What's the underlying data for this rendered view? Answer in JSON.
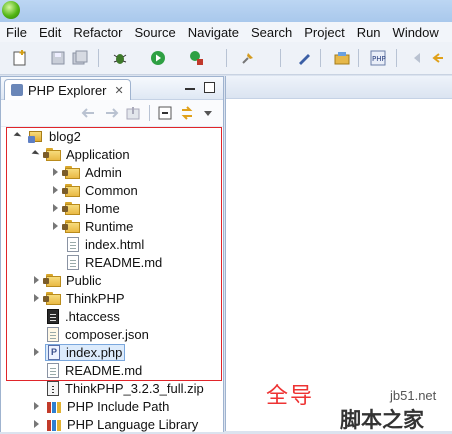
{
  "menu": [
    "File",
    "Edit",
    "Refactor",
    "Source",
    "Navigate",
    "Search",
    "Project",
    "Run",
    "Window"
  ],
  "explorer": {
    "tab_title": "PHP Explorer",
    "tab_close": "✕"
  },
  "tree": [
    {
      "label": "blog2"
    },
    {
      "label": "Application"
    },
    {
      "label": "Admin"
    },
    {
      "label": "Common"
    },
    {
      "label": "Home"
    },
    {
      "label": "Runtime"
    },
    {
      "label": "index.html"
    },
    {
      "label": "README.md"
    },
    {
      "label": "Public"
    },
    {
      "label": "ThinkPHP"
    },
    {
      "label": ".htaccess"
    },
    {
      "label": "composer.json"
    },
    {
      "label": "index.php"
    },
    {
      "label": "README.md"
    },
    {
      "label": "ThinkPHP_3.2.3_full.zip"
    },
    {
      "label": "PHP Include Path"
    },
    {
      "label": "PHP Language Library"
    }
  ],
  "annotation": {
    "chinese_text": "全导",
    "color": "#e0252a"
  },
  "watermark": {
    "url": "jb51.net",
    "logo": "脚本之家"
  },
  "colors": {
    "accent": "#7aa7dd",
    "folder": "#e9b945",
    "run": "#2ea043"
  }
}
